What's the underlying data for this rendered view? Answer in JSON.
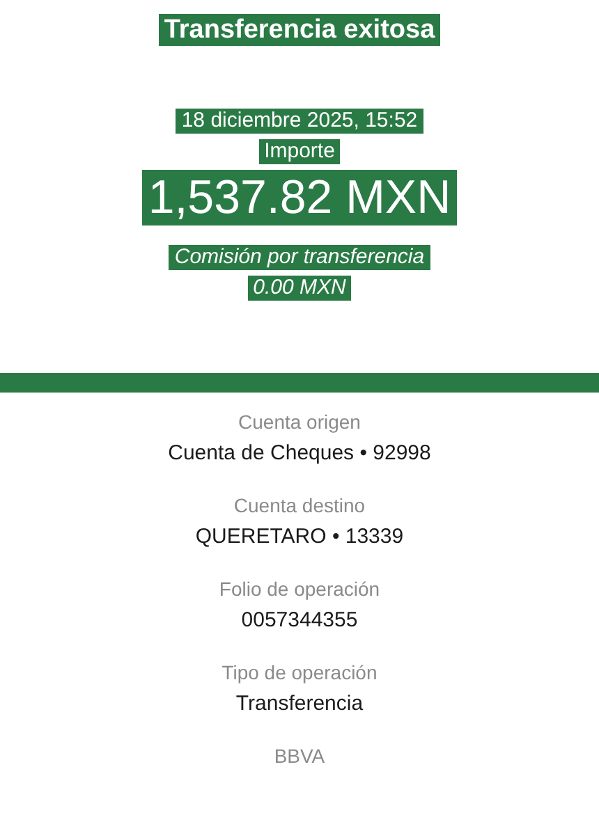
{
  "title": "Transferencia exitosa",
  "date": "18 diciembre 2025, 15:52",
  "amount_label": "Importe",
  "amount": "1,537.82 MXN",
  "fee_label": "Comisión por transferencia",
  "fee": "0.00 MXN",
  "details": [
    {
      "label": "Cuenta origen",
      "value": "Cuenta de Cheques • 92998"
    },
    {
      "label": "Cuenta destino",
      "value": "QUERETARO • 13339"
    },
    {
      "label": "Folio de operación",
      "value": "0057344355"
    },
    {
      "label": "Tipo de operación",
      "value": "Transferencia"
    },
    {
      "label": "BBVA"
    }
  ]
}
